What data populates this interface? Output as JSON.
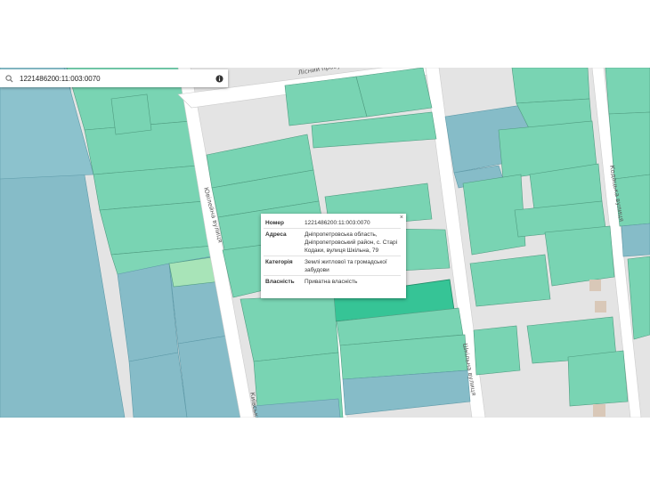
{
  "search": {
    "value": "1221486200:11:003:0070",
    "icon": "search-icon",
    "info_icon": "info-icon"
  },
  "map": {
    "streets": {
      "sidelane": "Лісний провулок",
      "yuvileina": "Ювілейна вулиця",
      "kyivska": "Київська",
      "shkilna": "Шкільна вулиця",
      "kodatska": "Кодацька вулиця"
    },
    "colors": {
      "parcel_green": "#79d4b3",
      "parcel_blue": "#86bcc8",
      "parcel_selected": "#36c496",
      "road": "#ffffff",
      "background": "#e4e4e4"
    }
  },
  "popup": {
    "close": "×",
    "rows": [
      {
        "key": "Номер",
        "value": "1221486200:11:003:0070"
      },
      {
        "key": "Адреса",
        "value": "Дніпропетровська область, Дніпропетровський район, с. Старі Кодаки, вулиця Шкільна, 79"
      },
      {
        "key": "Категорія",
        "value": "Землі житлової та громадської забудови"
      },
      {
        "key": "Власність",
        "value": "Приватна власність"
      }
    ]
  }
}
